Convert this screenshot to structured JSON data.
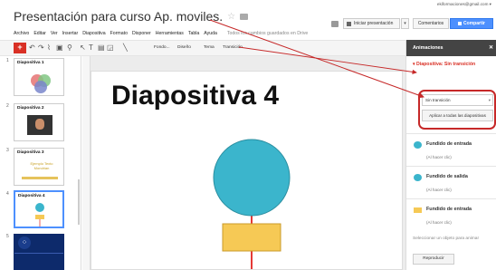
{
  "header": {
    "title": "Presentación para curso Ap. moviles.",
    "email": "ekiformaciones@gmail.com",
    "present_label": "Iniciar presentación",
    "comments_label": "Comentarios",
    "share_label": "Compartir"
  },
  "menu": {
    "items": [
      "Archivo",
      "Editar",
      "Ver",
      "Insertar",
      "Diapositiva",
      "Formato",
      "Disponer",
      "Herramientas",
      "Tabla",
      "Ayuda"
    ],
    "saved_status": "Todos los cambios guardados en Drive"
  },
  "toolbar": {
    "add_label": "+",
    "font_label": "Fondo...",
    "layout_label": "Diseño",
    "theme_label": "Tema",
    "transition_label": "Transición"
  },
  "filmstrip": {
    "slides": [
      {
        "num": "1",
        "title": "Diapositiva 1"
      },
      {
        "num": "2",
        "title": "Diapositiva 2"
      },
      {
        "num": "3",
        "title": "Diapositiva 3",
        "extra": "Ejemplo Texto Mondrian"
      },
      {
        "num": "4",
        "title": "Diapositiva 4"
      },
      {
        "num": "5",
        "title": ""
      }
    ]
  },
  "slide": {
    "title": "Diapositiva 4"
  },
  "panel": {
    "heading": "Animaciones",
    "selection": "Diapositiva: Sin transición",
    "transition_value": "Sin transición",
    "apply_all": "Aplicar a todas las diapositivas",
    "animations": [
      {
        "name": "Fundido de entrada",
        "when": "(Al hacer clic)",
        "shape": "circle"
      },
      {
        "name": "Fundido de salida",
        "when": "(Al hacer clic)",
        "shape": "circle"
      },
      {
        "name": "Fundido de entrada",
        "when": "(Al hacer clic)",
        "shape": "rect"
      }
    ],
    "select_hint": "Seleccionar un objeto para animar",
    "play_label": "Reproducir"
  },
  "colors": {
    "accent_red": "#d93025",
    "share_blue": "#4d90fe",
    "circle_fill": "#3bb5cc",
    "rect_fill": "#f6c955",
    "line_red": "#e53935"
  }
}
